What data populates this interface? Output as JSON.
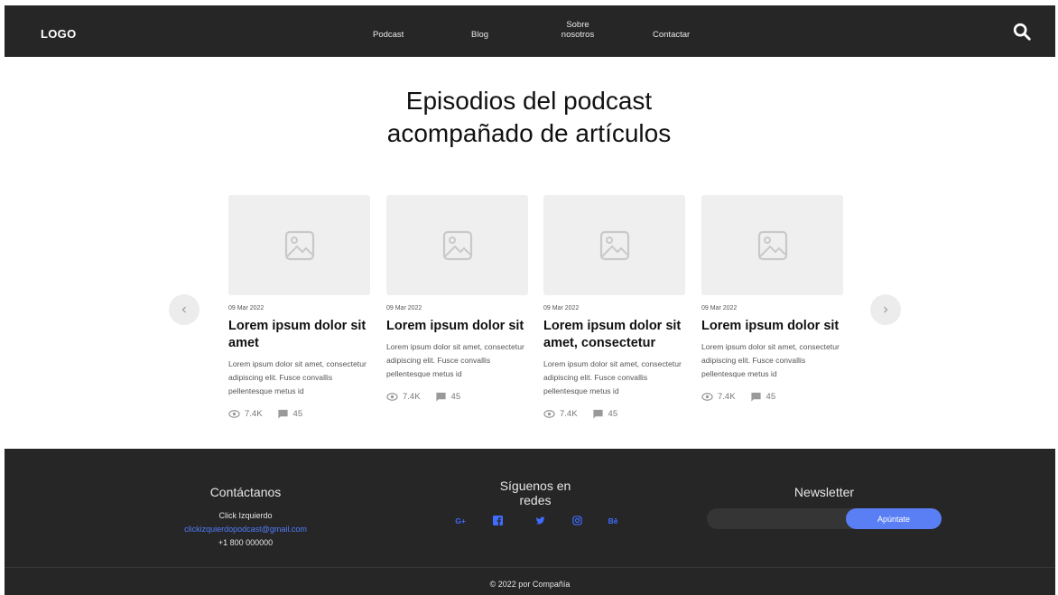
{
  "header": {
    "logo": "LOGO",
    "nav": [
      "Podcast",
      "Blog",
      "Sobre\nnosotros",
      "Contactar"
    ]
  },
  "hero": {
    "title_line1": "Episodios del podcast",
    "title_line2": "acompañado de artículos"
  },
  "cards": [
    {
      "date": "09 Mar 2022",
      "title": "Lorem ipsum dolor sit amet",
      "body": "Lorem ipsum dolor sit amet, consectetur adipiscing elit. Fusce convallis pellentesque metus id",
      "views": "7.4K",
      "comments": "45"
    },
    {
      "date": "09 Mar 2022",
      "title": "Lorem ipsum dolor sit",
      "body": "Lorem ipsum dolor sit amet, consectetur adipiscing elit. Fusce convallis pellentesque metus id",
      "views": "7.4K",
      "comments": "45"
    },
    {
      "date": "09 Mar 2022",
      "title": "Lorem ipsum dolor sit amet, consectetur",
      "body": "Lorem ipsum dolor sit amet, consectetur adipiscing elit. Fusce convallis pellentesque metus id",
      "views": "7.4K",
      "comments": "45"
    },
    {
      "date": "09 Mar 2022",
      "title": "Lorem ipsum dolor sit",
      "body": "Lorem ipsum dolor sit amet, consectetur adipiscing elit. Fusce convallis pellentesque metus id",
      "views": "7.4K",
      "comments": "45"
    }
  ],
  "footer": {
    "contact": {
      "heading": "Contáctanos",
      "name": "Click Izquierdo",
      "email": "clickizquierdopodcast@gmail.com",
      "phone": "+1 800 000000"
    },
    "social": {
      "heading": "Síguenos en\nredes",
      "icons": [
        "G+",
        "f",
        "twitter",
        "instagram",
        "Bē"
      ],
      "googleplus": "G+",
      "behance": "Bē"
    },
    "newsletter": {
      "heading": "Newsletter",
      "placeholder": "",
      "button": "Apúntate"
    },
    "copyright": "© 2022 por Compañía"
  },
  "colors": {
    "dark": "#262626",
    "accent": "#5a7ff5",
    "link": "#4f7dff"
  }
}
